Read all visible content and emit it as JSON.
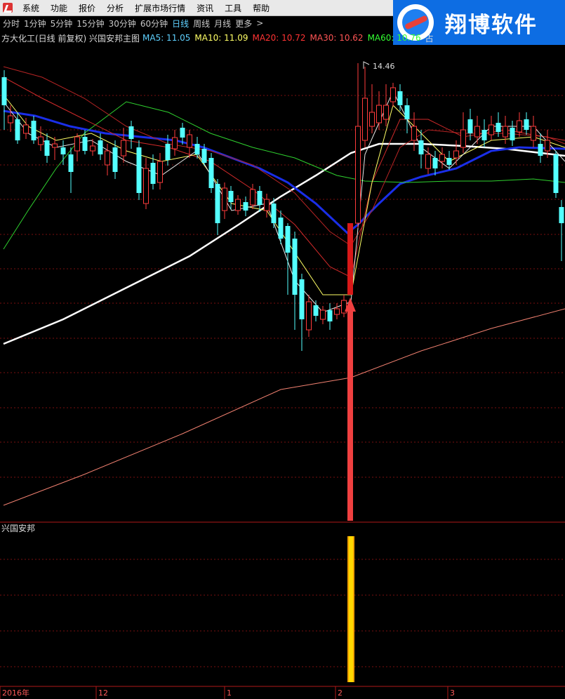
{
  "menu": {
    "items": [
      "系统",
      "功能",
      "报价",
      "分析",
      "扩展市场行情",
      "资讯",
      "工具",
      "帮助"
    ]
  },
  "logo": {
    "text": "翔博软件"
  },
  "periods": {
    "tabs": [
      "分时",
      "1分钟",
      "5分钟",
      "15分钟",
      "30分钟",
      "60分钟",
      "日线",
      "周线",
      "月线",
      "更多",
      ">"
    ],
    "active": "日线"
  },
  "header": {
    "title": "方大化工(日线 前复权) 兴国安邦主图",
    "ma5": "MA5: 11.05",
    "ma10": "MA10: 11.09",
    "ma20": "MA20: 10.72",
    "ma30": "MA30: 10.62",
    "ma60": "MA60: 10.76",
    "trail": "占"
  },
  "colors": {
    "ma5": "#ffffff",
    "ma10": "#ffff66",
    "ma20": "#ff3333",
    "ma30": "#ff5555",
    "ma60": "#33ff33",
    "up": "#ff3b3b",
    "down": "#54ffff",
    "thick_blue": "#1a2ee8",
    "thick_white": "#ffffff"
  },
  "price_marker": {
    "label": "14.46"
  },
  "subpanel": {
    "title": "兴国安邦"
  },
  "time_axis": {
    "labels": [
      "2016年",
      "12",
      "1",
      "2",
      "3"
    ]
  },
  "chart_data": {
    "type": "line",
    "series": [
      {
        "name": "MA5",
        "value": 11.05
      },
      {
        "name": "MA10",
        "value": 11.09
      },
      {
        "name": "MA20",
        "value": 10.72
      },
      {
        "name": "MA30",
        "value": 10.62
      },
      {
        "name": "MA60",
        "value": 10.76
      }
    ],
    "high_label": 14.46
  }
}
